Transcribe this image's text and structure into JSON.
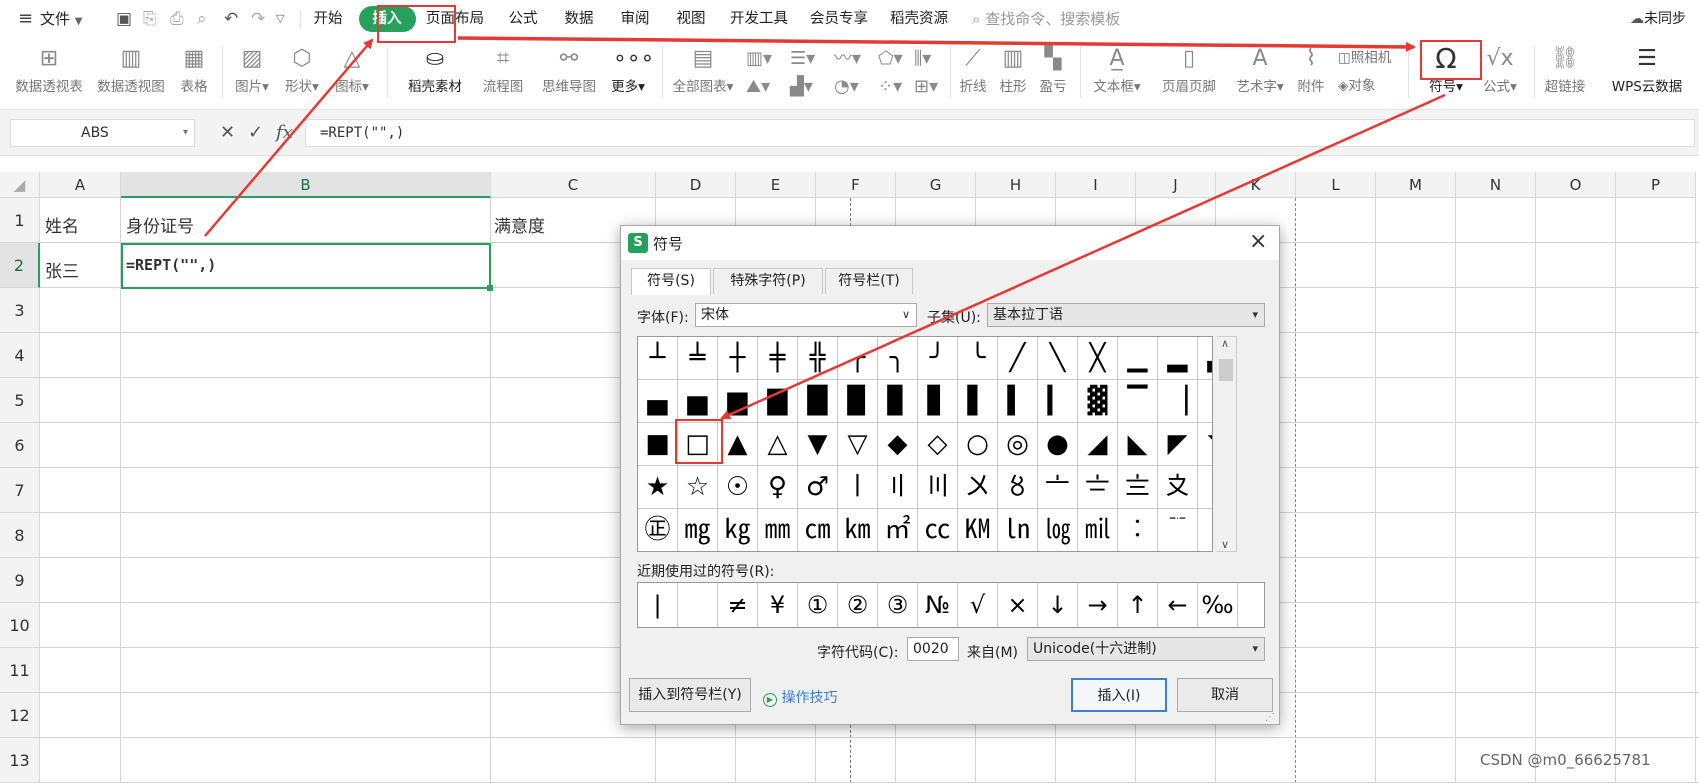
{
  "menubar": {
    "file_label": "文件",
    "tabs": [
      "开始",
      "插入",
      "页面布局",
      "公式",
      "数据",
      "审阅",
      "视图",
      "开发工具",
      "会员专享",
      "稻壳资源"
    ],
    "active_tab": "插入",
    "search_placeholder": "查找命令、搜索模板",
    "sync_label": "未同步"
  },
  "ribbon": {
    "items": [
      "数据透视表",
      "数据透视图",
      "表格",
      "图片",
      "形状",
      "图标",
      "稻壳素材",
      "流程图",
      "思维导图",
      "更多",
      "全部图表",
      "折线",
      "柱形",
      "盈亏",
      "文本框",
      "页眉页脚",
      "艺术字",
      "附件",
      "照相机",
      "对象",
      "符号",
      "公式",
      "超链接",
      "WPS云数据"
    ]
  },
  "formula_bar": {
    "name_box": "ABS",
    "formula": "=REPT(\"\",)",
    "fx_label": "fx"
  },
  "sheet": {
    "columns": [
      "A",
      "B",
      "C",
      "D",
      "E",
      "F",
      "G",
      "H",
      "I",
      "J",
      "K",
      "L",
      "M",
      "N",
      "O",
      "P"
    ],
    "rows": [
      "1",
      "2",
      "3",
      "4",
      "5",
      "6",
      "7",
      "8",
      "9",
      "10",
      "11",
      "12",
      "13"
    ],
    "selected_column": "B",
    "selected_row": "2",
    "cells": {
      "A1": "姓名",
      "B1": "身份证号",
      "C1": "满意度",
      "A2": "张三",
      "B2": "=REPT(\"\",)"
    }
  },
  "dialog": {
    "title": "符号",
    "close_glyph": "×",
    "tabs": [
      "符号(S)",
      "特殊字符(P)",
      "符号栏(T)"
    ],
    "font_label": "字体(F):",
    "font_value": "宋体",
    "subset_label": "子集(U):",
    "subset_value": "基本拉丁语",
    "symbols": [
      [
        "┴",
        "╧",
        "┼",
        "╪",
        "╬",
        "╭",
        "╮",
        "╯",
        "╰",
        "╱",
        "╲",
        "╳",
        "▁",
        "▂",
        "▃"
      ],
      [
        "▄",
        "▅",
        "▆",
        "▇",
        "█",
        "▉",
        "▊",
        "▋",
        "▌",
        "▍",
        "▎",
        "▓",
        "▔",
        "▕",
        ""
      ],
      [
        "■",
        "□",
        "▲",
        "△",
        "▼",
        "▽",
        "◆",
        "◇",
        "○",
        "◎",
        "●",
        "◢",
        "◣",
        "◤",
        "◥"
      ],
      [
        "★",
        "☆",
        "☉",
        "♀",
        "♂",
        "〡",
        "〢",
        "〣",
        "〤",
        "〥",
        "〦",
        "〧",
        "〨",
        "〩",
        ""
      ],
      [
        "㊣",
        "㎎",
        "㎏",
        "㎜",
        "㎝",
        "㎞",
        "㎡",
        "㏄",
        "㏎",
        "㏑",
        "㏒",
        "㏕",
        "︰",
        "﹊",
        ""
      ]
    ],
    "recent_label": "近期使用过的符号(R):",
    "recent": [
      "|",
      " ",
      "≠",
      "¥",
      "①",
      "②",
      "③",
      "№",
      "√",
      "×",
      "↓",
      "→",
      "↑",
      "←",
      "‰"
    ],
    "code_label": "字符代码(C):",
    "code_value": "0020",
    "from_label": "来自(M)",
    "from_value": "Unicode(十六进制)",
    "insert_to_bar": "插入到符号栏(Y)",
    "tips": "操作技巧",
    "insert": "插入(I)",
    "cancel": "取消"
  },
  "watermark": "CSDN @m0_66625781",
  "colors": {
    "accent_green": "#27a05c",
    "annotation_red": "#e53935",
    "selection_green": "#1d6e3c"
  }
}
